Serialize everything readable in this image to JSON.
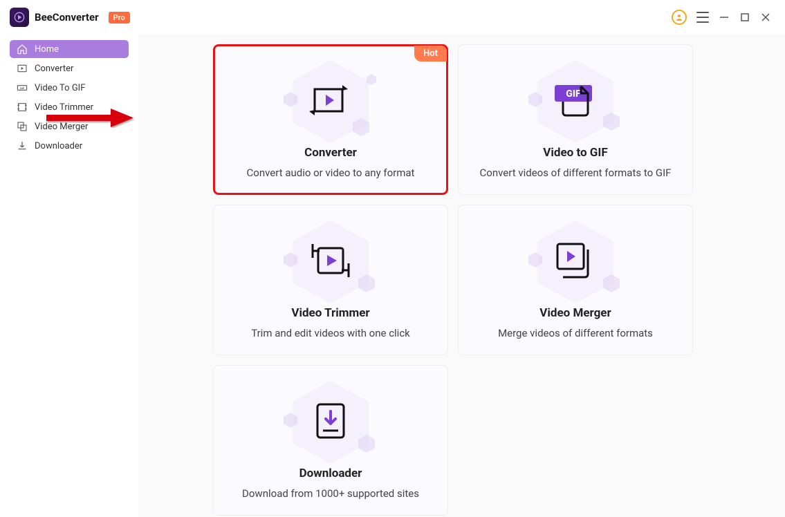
{
  "app": {
    "name": "BeeConverter",
    "badge": "Pro"
  },
  "sidebar": {
    "items": [
      {
        "label": "Home"
      },
      {
        "label": "Converter"
      },
      {
        "label": "Video To GIF"
      },
      {
        "label": "Video Trimmer"
      },
      {
        "label": "Video Merger"
      },
      {
        "label": "Downloader"
      }
    ]
  },
  "cards": {
    "hot_label": "Hot",
    "converter": {
      "title": "Converter",
      "desc": "Convert audio or video to any format"
    },
    "gif": {
      "title": "Video to GIF",
      "desc": "Convert videos of different formats to GIF"
    },
    "trimmer": {
      "title": "Video Trimmer",
      "desc": "Trim and edit videos with one click"
    },
    "merger": {
      "title": "Video Merger",
      "desc": "Merge videos of different formats"
    },
    "downloader": {
      "title": "Downloader",
      "desc": "Download from 1000+ supported sites"
    }
  },
  "colors": {
    "accent": "#7b3fd4",
    "hot": "#ff7a4d",
    "badge": "#ff6b3d"
  }
}
